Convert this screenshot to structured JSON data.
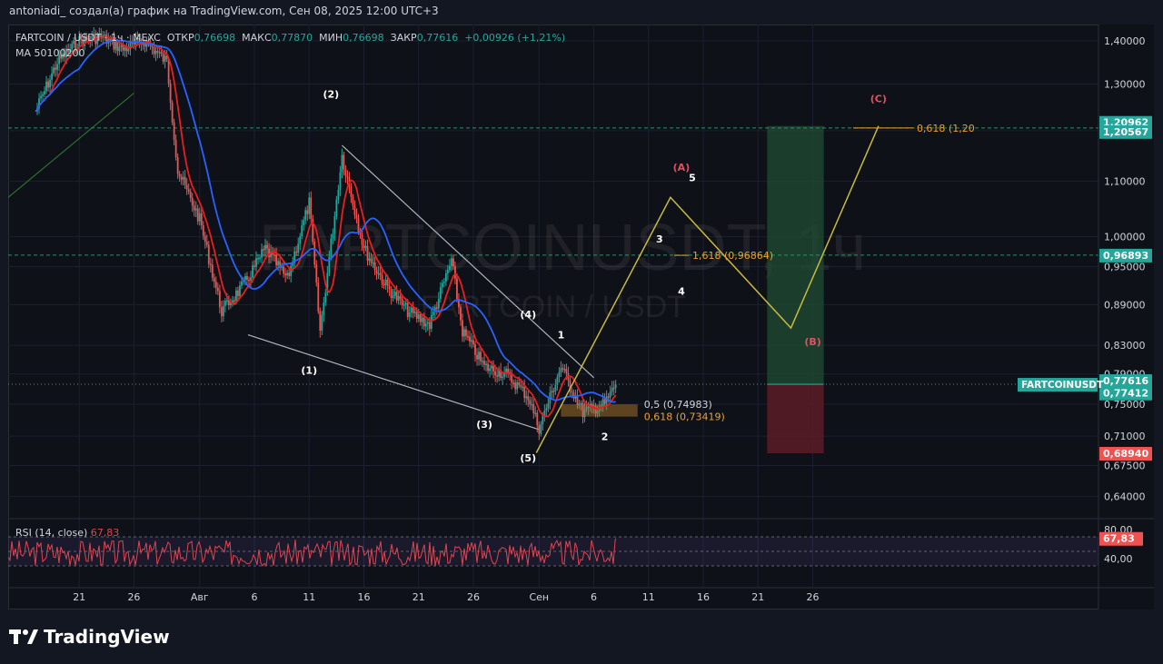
{
  "header": {
    "text": "antoniadi_ создал(а) график на TradingView.com, Сен 08, 2025 12:00 UTC+3"
  },
  "legend": {
    "symbol": "FARTCOIN / USDT · 1ч · MEXC",
    "open_label": "ОТКР",
    "open_value": "0,76698",
    "high_label": "МАКС",
    "high_value": "0,77870",
    "low_label": "МИН",
    "low_value": "0,76698",
    "close_label": "ЗАКР",
    "close_value": "0,77616",
    "change": "+0,00926 (+1,21%)",
    "ma": "MA 50100200",
    "rsi_label": "RSI (14, close)",
    "rsi_value": "67,83"
  },
  "watermark": {
    "main": "FARTCOINUSDT, 1ч",
    "sub": "FARTCOIN / USDT"
  },
  "logo": {
    "text": "TradingView"
  },
  "colors": {
    "background": "#0e1117",
    "up": "#26a69a",
    "down": "#ef5350",
    "ma_fast": "#e91e1e",
    "ma_slow": "#2962ff",
    "projection": "#c9b93f",
    "fib": "#f0a030",
    "rsi": "#e0454f",
    "target_zone": "#1f4a32",
    "stop_zone": "#5a1c26"
  },
  "chart_data": {
    "type": "line",
    "title": "FARTCOIN / USDT · 1ч · MEXC",
    "scale": "log",
    "ylim": [
      0.62,
      1.44
    ],
    "y_ticks": [
      "1,40000",
      "1,30000",
      "1,20000",
      "1,10000",
      "1,00000",
      "0,95000",
      "0,89000",
      "0,83000",
      "0,79000",
      "0,75000",
      "0,71000",
      "0,67500",
      "0,64000"
    ],
    "x_ticks": [
      "21",
      "26",
      "Авг",
      "6",
      "11",
      "16",
      "21",
      "26",
      "Сен",
      "6",
      "11",
      "16",
      "21",
      "26"
    ],
    "price_path": {
      "x": [
        "Jul 17",
        "Jul 19",
        "Jul 21",
        "Jul 23",
        "Jul 25",
        "Jul 27",
        "Jul 29",
        "Jul 30",
        "Aug 1",
        "Aug 3",
        "Aug 5",
        "Aug 7",
        "Aug 9",
        "Aug 11",
        "Aug 12",
        "Aug 14",
        "Aug 16",
        "Aug 18",
        "Aug 20",
        "Aug 22",
        "Aug 24",
        "Aug 25",
        "Aug 27",
        "Aug 29",
        "Aug 31",
        "Sep 1",
        "Sep 3",
        "Sep 5",
        "Sep 7",
        "Sep 8"
      ],
      "y": [
        1.24,
        1.35,
        1.4,
        1.41,
        1.38,
        1.4,
        1.35,
        1.12,
        1.03,
        0.88,
        0.92,
        0.98,
        0.93,
        1.06,
        0.85,
        1.15,
        0.98,
        0.92,
        0.88,
        0.86,
        0.96,
        0.85,
        0.8,
        0.79,
        0.76,
        0.72,
        0.8,
        0.74,
        0.75,
        0.776
      ]
    },
    "projection": {
      "x": [
        "Sep 1",
        "Sep 13",
        "Sep 24",
        "Oct 2"
      ],
      "y": [
        0.69,
        1.07,
        0.855,
        1.2096
      ]
    },
    "wave_labels": [
      {
        "text": "(1)",
        "x": "Aug 11",
        "y": 0.79,
        "color": "#ffffff"
      },
      {
        "text": "(2)",
        "x": "Aug 13",
        "y": 1.27,
        "color": "#ffffff"
      },
      {
        "text": "(3)",
        "x": "Aug 27",
        "y": 0.72,
        "color": "#ffffff"
      },
      {
        "text": "(4)",
        "x": "Aug 31",
        "y": 0.87,
        "color": "#ffffff"
      },
      {
        "text": "(5)",
        "x": "Aug 31",
        "y": 0.68,
        "color": "#ffffff"
      },
      {
        "text": "1",
        "x": "Sep 3",
        "y": 0.84,
        "color": "#ffffff"
      },
      {
        "text": "2",
        "x": "Sep 7",
        "y": 0.705,
        "color": "#ffffff"
      },
      {
        "text": "3",
        "x": "Sep 12",
        "y": 0.99,
        "color": "#ffffff"
      },
      {
        "text": "4",
        "x": "Sep 14",
        "y": 0.905,
        "color": "#ffffff"
      },
      {
        "text": "5",
        "x": "Sep 15",
        "y": 1.1,
        "color": "#ffffff"
      },
      {
        "text": "(A)",
        "x": "Sep 14",
        "y": 1.12,
        "color": "#e05060"
      },
      {
        "text": "(B)",
        "x": "Sep 26",
        "y": 0.83,
        "color": "#e05060"
      },
      {
        "text": "(C)",
        "x": "Oct 2",
        "y": 1.26,
        "color": "#e05060"
      }
    ],
    "levels": [
      {
        "label": "0,5 (0,74983)",
        "value": 0.74983,
        "color": "#d1d4dc"
      },
      {
        "label": "0,618 (0,73419)",
        "value": 0.73419,
        "color": "#f0a030"
      },
      {
        "label": "1,618 (0,96864)",
        "value": 0.96864,
        "color": "#f0a030"
      },
      {
        "label": "0,618 (1,20",
        "value": 1.20567,
        "color": "#f0a030"
      }
    ],
    "price_tags": [
      {
        "text": "1,20962",
        "value": 1.20962,
        "color": "#26a69a"
      },
      {
        "text": "1,20567",
        "value": 1.20567,
        "color": "#26a69a"
      },
      {
        "text": "0,96893",
        "value": 0.96893,
        "color": "#26a69a"
      },
      {
        "text": "0,77616",
        "value": 0.77616,
        "color": "#26a69a"
      },
      {
        "text": "0,77412",
        "value": 0.77412,
        "color": "#26a69a"
      },
      {
        "text": "0,68940",
        "value": 0.6894,
        "color": "#ef5350"
      }
    ],
    "symbol_tag": "FARTCOINUSDT",
    "long_position": {
      "entry": 0.77616,
      "target": 1.20962,
      "stop": 0.6894
    },
    "rsi": {
      "ylim": [
        20,
        90
      ],
      "ticks": [
        "80,00",
        "40,00"
      ],
      "last": 67.83
    }
  }
}
